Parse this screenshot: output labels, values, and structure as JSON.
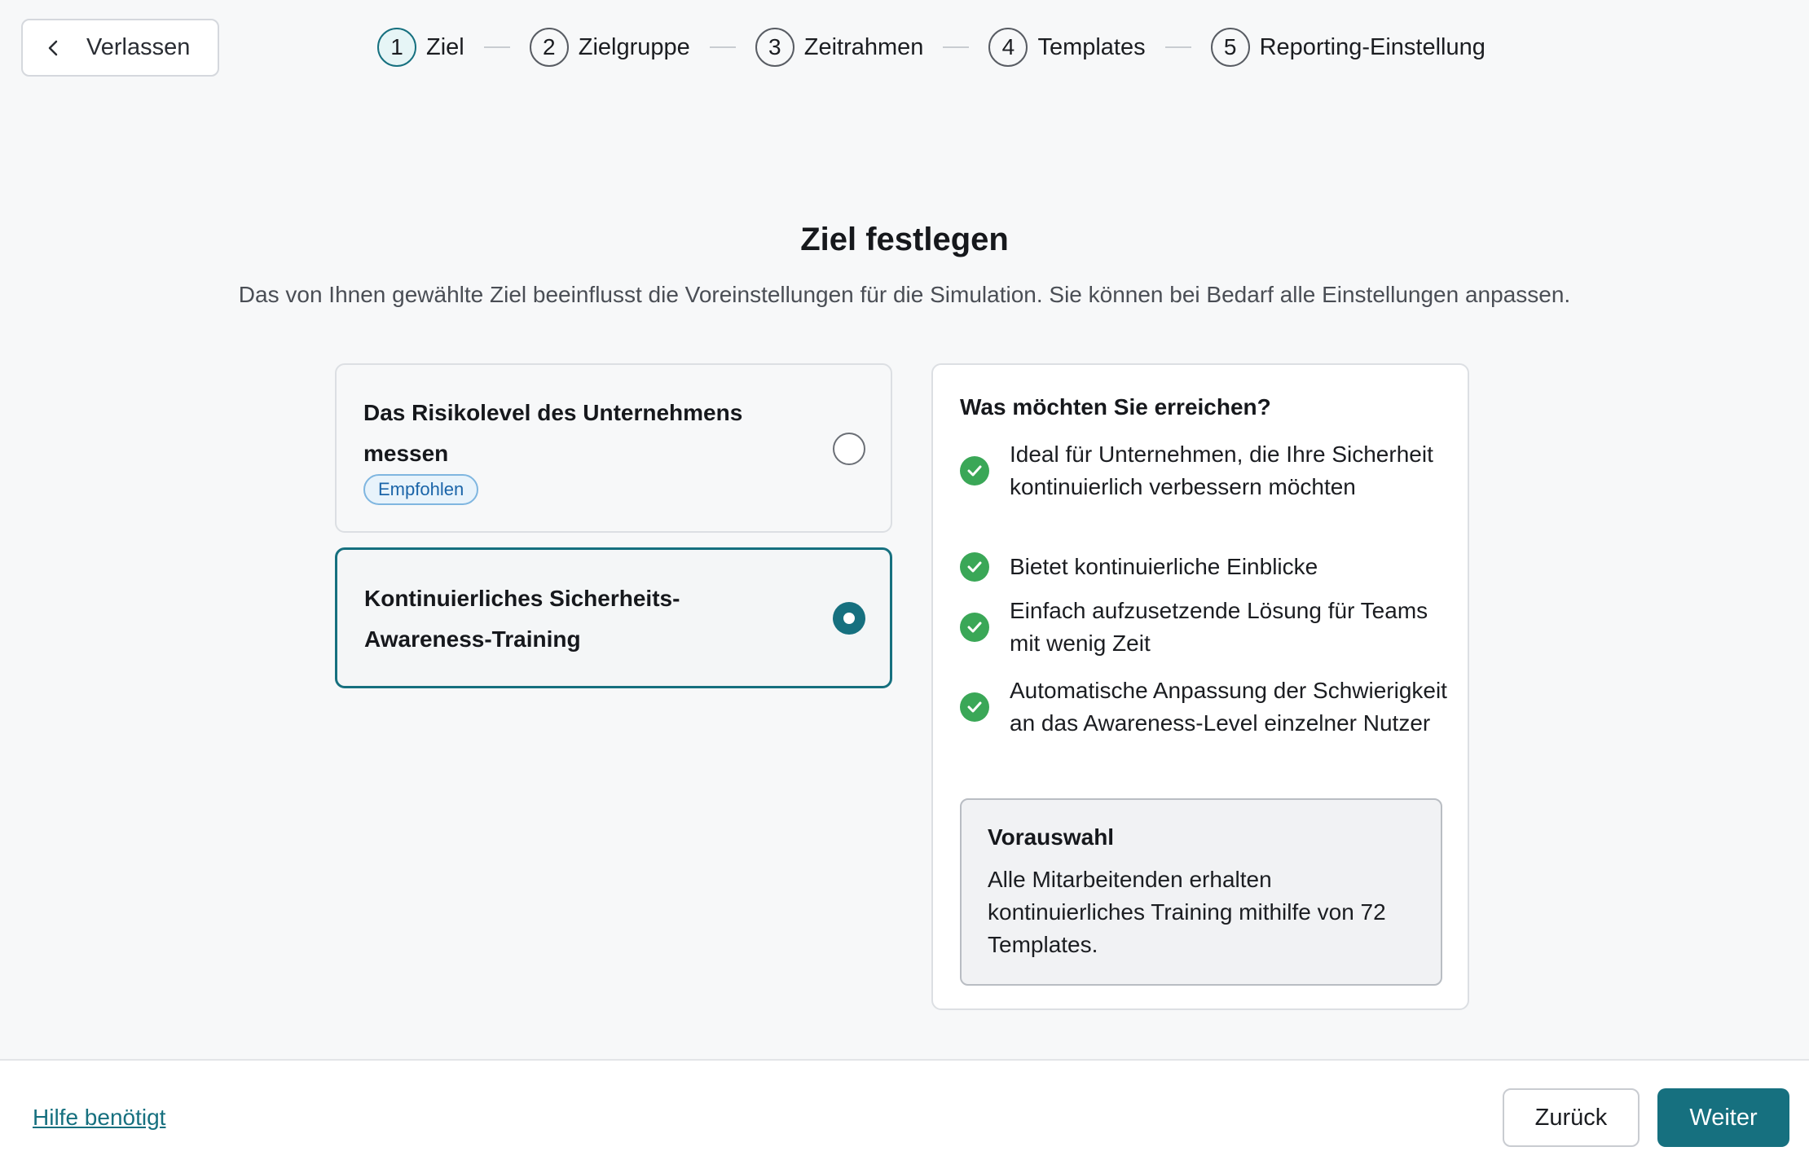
{
  "header": {
    "exit_label": "Verlassen",
    "steps": [
      {
        "number": "1",
        "label": "Ziel",
        "active": true
      },
      {
        "number": "2",
        "label": "Zielgruppe",
        "active": false
      },
      {
        "number": "3",
        "label": "Zeitrahmen",
        "active": false
      },
      {
        "number": "4",
        "label": "Templates",
        "active": false
      },
      {
        "number": "5",
        "label": "Reporting-Einstellung",
        "active": false
      }
    ]
  },
  "main": {
    "title": "Ziel festlegen",
    "subtitle": "Das von Ihnen gewählte Ziel beeinflusst die Voreinstellungen für die Simulation. Sie können bei Bedarf alle Einstellungen anpassen.",
    "options": [
      {
        "title": "Das Risikolevel des Unternehmens messen",
        "badge": "Empfohlen",
        "selected": false
      },
      {
        "title": "Kontinuierliches Sicherheits-Awareness-Training",
        "selected": true
      }
    ],
    "info": {
      "title": "Was möchten Sie erreichen?",
      "benefits": [
        "Ideal für Unternehmen, die Ihre Sicherheit kontinuierlich verbessern möchten",
        "Bietet kontinuierliche Einblicke",
        "Einfach aufzusetzende Lösung für Teams mit wenig Zeit",
        "Automatische Anpassung der Schwierigkeit an das Awareness-Level einzelner Nutzer"
      ],
      "preset_title": "Vorauswahl",
      "preset_text": "Alle Mitarbeitenden erhalten kontinuierliches Training mithilfe von 72 Templates."
    }
  },
  "footer": {
    "help_label": "Hilfe benötigt",
    "back_label": "Zurück",
    "next_label": "Weiter"
  },
  "colors": {
    "accent": "#16707f",
    "success": "#3aa757",
    "badge_text": "#1a64a8",
    "background": "#f7f8f9"
  }
}
